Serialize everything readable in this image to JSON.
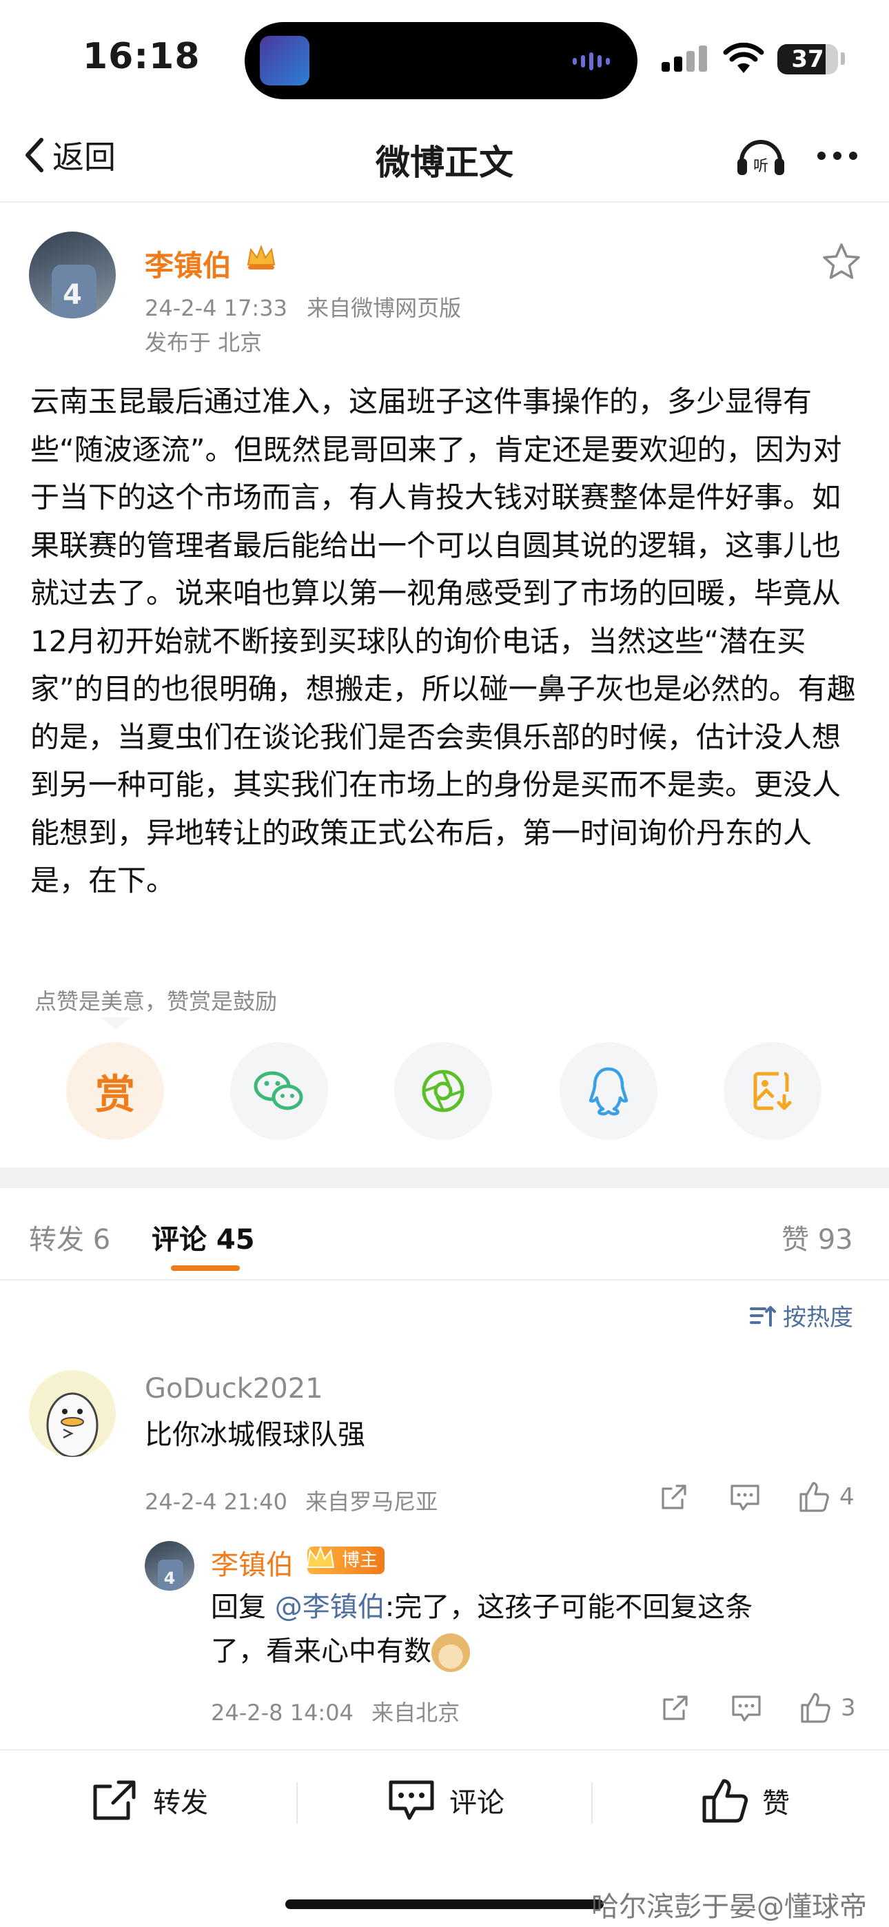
{
  "status": {
    "time": "16:18",
    "battery": "37"
  },
  "nav": {
    "back_label": "返回",
    "title": "微博正文"
  },
  "post": {
    "author": "李镇伯",
    "timestamp": "24-2-4 17:33",
    "source": "来自微博网页版",
    "location": "发布于 北京",
    "avatar_number": "4",
    "body": "云南玉昆最后通过准入，这届班子这件事操作的，多少显得有些“随波逐流”。但既然昆哥回来了，肯定还是要欢迎的，因为对于当下的这个市场而言，有人肯投大钱对联赛整体是件好事。如果联赛的管理者最后能给出一个可以自圆其说的逻辑，这事儿也就过去了。说来咱也算以第一视角感受到了市场的回暖，毕竟从12月初开始就不断接到买球队的询价电话，当然这些“潜在买家”的目的也很明确，想搬走，所以碰一鼻子灰也是必然的。有趣的是，当夏虫们在谈论我们是否会卖俱乐部的时候，估计没人想到另一种可能，其实我们在市场上的身份是买而不是卖。更没人能想到，异地转让的政策正式公布后，第一时间询价丹东的人是，在下。"
  },
  "reward": {
    "hint": "点赞是美意，赞赏是鼓励",
    "reward_char": "赏"
  },
  "share_icons": [
    "reward-icon",
    "wechat-icon",
    "moments-icon",
    "qq-icon",
    "save-image-icon"
  ],
  "tabs": {
    "repost": "转发 6",
    "comments": "评论 45",
    "likes": "赞 93"
  },
  "sort_label": "按热度",
  "comments": [
    {
      "user": "GoDuck2021",
      "text": "比你冰城假球队强",
      "time": "24-2-4 21:40",
      "source": "来自罗马尼亚",
      "likes": "4",
      "reply": {
        "user": "李镇伯",
        "badge": "博主",
        "prefix": "回复 ",
        "mention": "@李镇伯",
        "text_line1": ":完了，这孩子可能不回复这条",
        "text_line2": "了，看来心中有数",
        "time": "24-2-8 14:04",
        "source": "来自北京",
        "likes": "3"
      }
    }
  ],
  "bottom_bar": {
    "repost": "转发",
    "comment": "评论",
    "like": "赞"
  },
  "watermark": "哈尔滨彭于晏@懂球帝",
  "colors": {
    "accent": "#f07b1a",
    "link": "#4f6f9e",
    "muted": "#8b8b8b"
  }
}
